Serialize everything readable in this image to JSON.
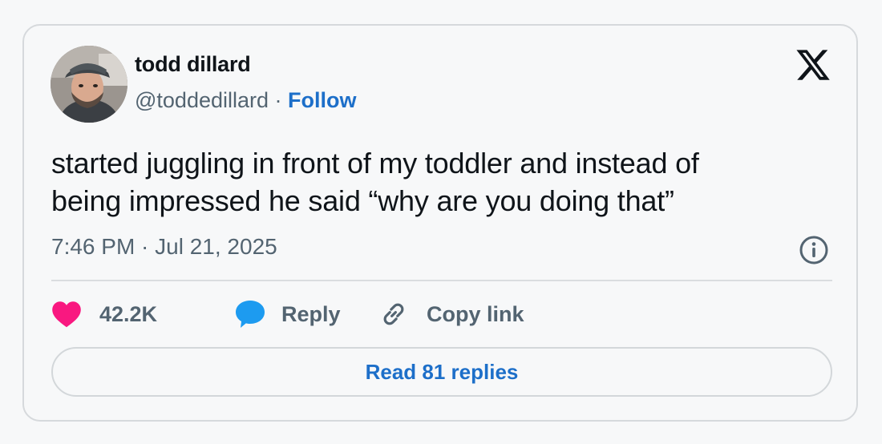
{
  "author": {
    "name": "todd dillard",
    "handle": "@toddedillard",
    "separator": " · ",
    "follow_label": "Follow"
  },
  "tweet": {
    "line1": "started juggling in front of my toddler and instead of",
    "line2": "being impressed he said “why are you doing that”",
    "timestamp": "7:46 PM · Jul 21, 2025"
  },
  "actions": {
    "likes": "42.2K",
    "reply_label": "Reply",
    "copy_link_label": "Copy link"
  },
  "read_replies_label": "Read 81 replies",
  "icons": {
    "platform_logo": "x-logo-icon",
    "like": "heart-icon",
    "reply": "speech-bubble-icon",
    "copy": "link-icon",
    "info": "info-icon"
  },
  "colors": {
    "heart": "#f91880",
    "reply_bubble": "#1d9bf0",
    "link_blue": "#1d6fc9",
    "muted_text": "#536471"
  }
}
